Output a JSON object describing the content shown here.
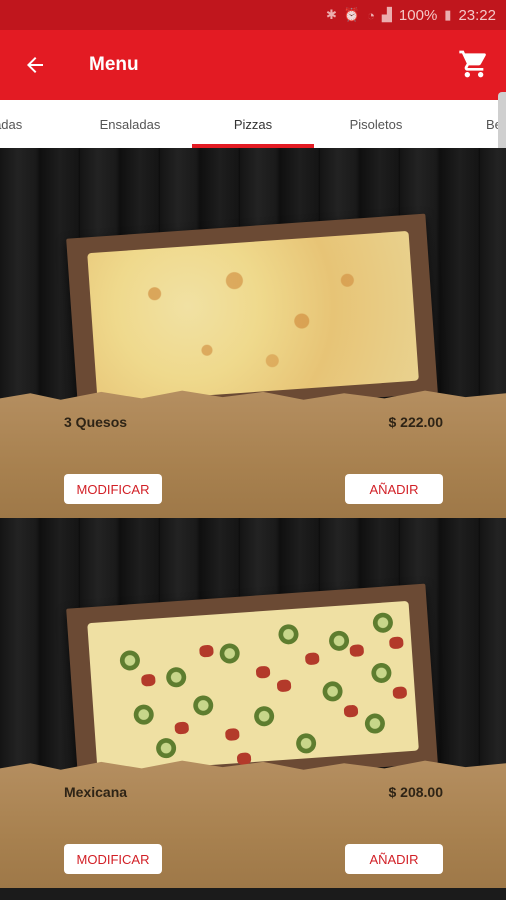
{
  "status": {
    "signal_text": "100%",
    "time": "23:22"
  },
  "app_bar": {
    "title": "Menu"
  },
  "tabs": [
    {
      "label": "radas"
    },
    {
      "label": "Ensaladas"
    },
    {
      "label": "Pizzas"
    },
    {
      "label": "Pisoletos"
    },
    {
      "label": "Bebi"
    }
  ],
  "active_tab": "Pizzas",
  "products": [
    {
      "name": "3 Quesos",
      "price": "$ 222.00",
      "modify_label": "MODIFICAR",
      "add_label": "AÑADIR"
    },
    {
      "name": "Mexicana",
      "price": "$ 208.00",
      "modify_label": "MODIFICAR",
      "add_label": "AÑADIR"
    }
  ],
  "colors": {
    "primary": "#e31b23",
    "status": "#c0161d",
    "paper": "#a8814f",
    "wood": "#1b1b1b"
  }
}
